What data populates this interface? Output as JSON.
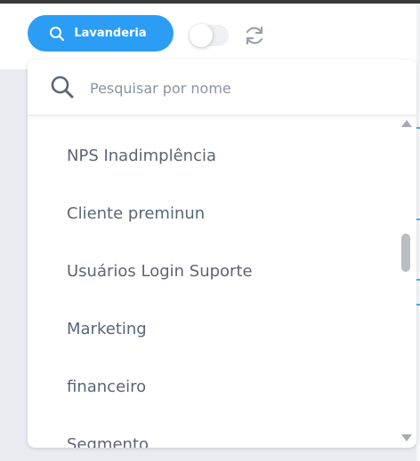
{
  "header": {
    "filter_button_label": "Lavanderia",
    "search_icon": "search-icon",
    "toggle_state": "off",
    "refresh_icon": "refresh-icon"
  },
  "dropdown": {
    "search_placeholder": "Pesquisar por nome",
    "search_value": "",
    "items": [
      "NPS Inadimplência",
      "Cliente preminun",
      "Usuários Login Suporte",
      "Marketing",
      "financeiro",
      "Segmento"
    ]
  },
  "colors": {
    "accent": "#2b9df5",
    "text": "#5b6577",
    "placeholder": "#8a93a3"
  }
}
